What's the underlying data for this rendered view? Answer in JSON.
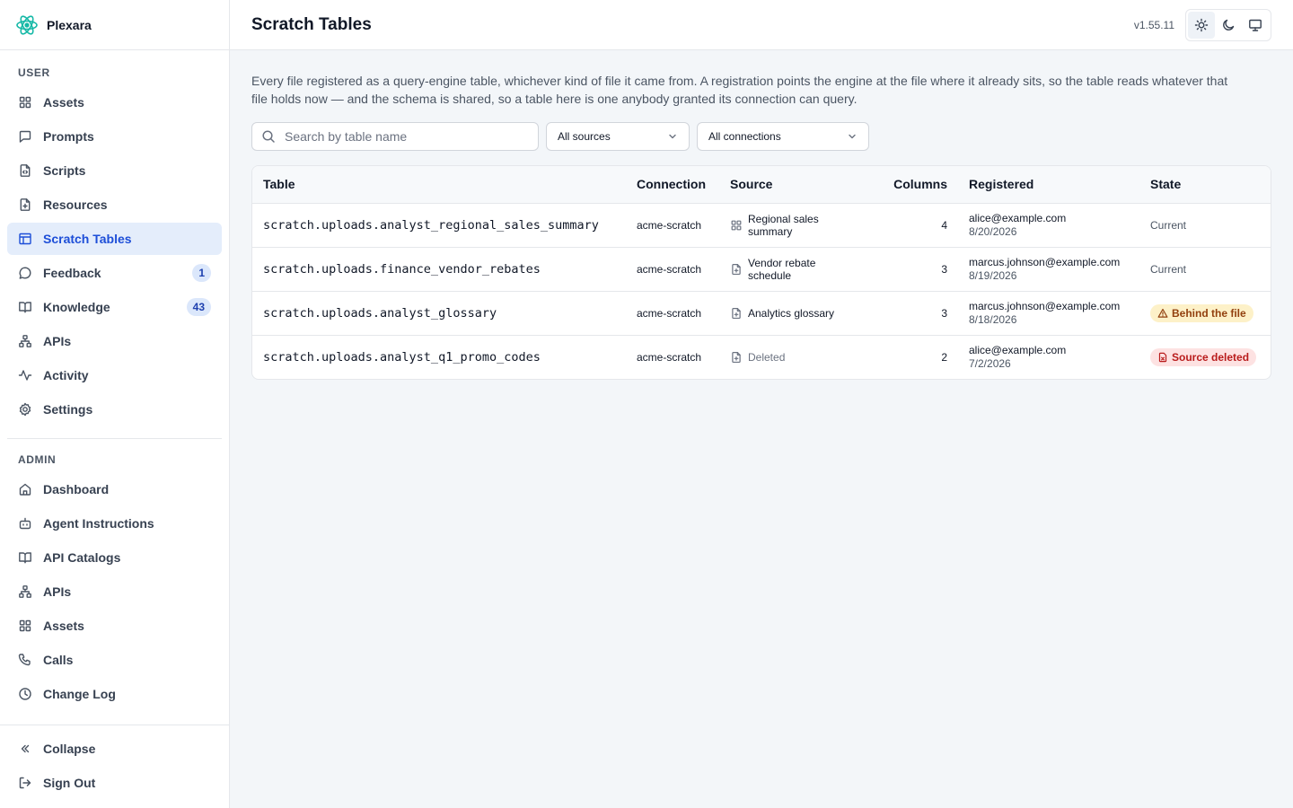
{
  "brand": {
    "name": "Plexara"
  },
  "sidebar": {
    "user_label": "USER",
    "user_items": [
      {
        "label": "Assets",
        "icon": "grid-icon"
      },
      {
        "label": "Prompts",
        "icon": "message-square-icon"
      },
      {
        "label": "Scripts",
        "icon": "file-code-icon"
      },
      {
        "label": "Resources",
        "icon": "file-plus-icon"
      },
      {
        "label": "Scratch Tables",
        "icon": "table-icon",
        "active": true
      },
      {
        "label": "Feedback",
        "icon": "message-circle-icon",
        "badge": "1"
      },
      {
        "label": "Knowledge",
        "icon": "book-open-icon",
        "badge": "43"
      },
      {
        "label": "APIs",
        "icon": "network-icon"
      },
      {
        "label": "Activity",
        "icon": "activity-icon"
      },
      {
        "label": "Settings",
        "icon": "gear-icon"
      }
    ],
    "admin_label": "ADMIN",
    "admin_items": [
      {
        "label": "Dashboard",
        "icon": "home-icon"
      },
      {
        "label": "Agent Instructions",
        "icon": "bot-icon"
      },
      {
        "label": "API Catalogs",
        "icon": "book-open-icon"
      },
      {
        "label": "APIs",
        "icon": "network-icon"
      },
      {
        "label": "Assets",
        "icon": "grid-icon"
      },
      {
        "label": "Calls",
        "icon": "phone-icon"
      },
      {
        "label": "Change Log",
        "icon": "clock-icon"
      }
    ],
    "collapse_label": "Collapse",
    "signout_label": "Sign Out"
  },
  "header": {
    "title": "Scratch Tables",
    "version": "v1.55.11"
  },
  "main": {
    "description": "Every file registered as a query-engine table, whichever kind of file it came from. A registration points the engine at the file where it already sits, so the table reads whatever that file holds now — and the schema is shared, so a table here is one anybody granted its connection can query.",
    "search_placeholder": "Search by table name",
    "source_filter": "All sources",
    "connection_filter": "All connections",
    "columns": {
      "table": "Table",
      "connection": "Connection",
      "source": "Source",
      "columns": "Columns",
      "registered": "Registered",
      "state": "State"
    },
    "rows": [
      {
        "table": "scratch.uploads.analyst_regional_sales_summary",
        "connection": "acme-scratch",
        "source": "Regional sales summary",
        "source_icon": "grid-icon",
        "columns": "4",
        "email": "alice@example.com",
        "date": "8/20/2026",
        "state": "Current",
        "state_kind": "plain"
      },
      {
        "table": "scratch.uploads.finance_vendor_rebates",
        "connection": "acme-scratch",
        "source": "Vendor rebate schedule",
        "source_icon": "file-plus-icon",
        "columns": "3",
        "email": "marcus.johnson@example.com",
        "date": "8/19/2026",
        "state": "Current",
        "state_kind": "plain"
      },
      {
        "table": "scratch.uploads.analyst_glossary",
        "connection": "acme-scratch",
        "source": "Analytics glossary",
        "source_icon": "file-plus-icon",
        "columns": "3",
        "email": "marcus.johnson@example.com",
        "date": "8/18/2026",
        "state": "Behind the file",
        "state_kind": "warn"
      },
      {
        "table": "scratch.uploads.analyst_q1_promo_codes",
        "connection": "acme-scratch",
        "source": "Deleted",
        "source_icon": "file-plus-icon",
        "columns": "2",
        "email": "alice@example.com",
        "date": "7/2/2026",
        "state": "Source deleted",
        "state_kind": "err"
      }
    ]
  },
  "colors": {
    "accent": "#1d4ed8",
    "active_bg": "#e4edfb",
    "warn_bg": "#fdf1c8",
    "err_bg": "#fde2e2"
  }
}
